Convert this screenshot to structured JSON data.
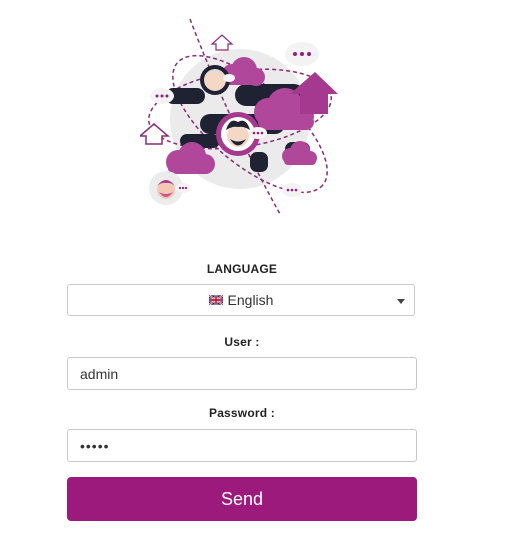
{
  "language": {
    "label": "LANGUAGE",
    "selected": "English",
    "flag_icon": "uk-flag-icon"
  },
  "user": {
    "label": "User :",
    "value": "admin"
  },
  "password": {
    "label": "Password :",
    "value": "•••••"
  },
  "send_button": {
    "label": "Send"
  },
  "colors": {
    "accent": "#9b1a7b",
    "dark": "#1f2233",
    "cloud": "#b0479a"
  }
}
